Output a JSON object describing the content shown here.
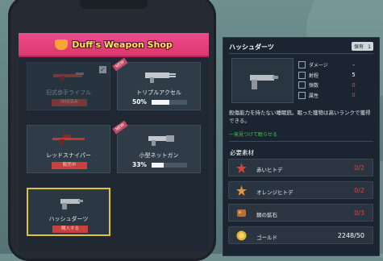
{
  "shop": {
    "title": "Duff's Weapon Shop",
    "cards": [
      {
        "name": "旧式歩手ライフル",
        "status": "owned",
        "price": "所持済み",
        "gun_color": "#b34b3e",
        "badge": ""
      },
      {
        "name": "トリプルアクセル",
        "status": "progress",
        "progress_label": "50%",
        "progress_fraction": 0.5,
        "gun_color": "#c3c8ce",
        "badge": "NEW"
      },
      {
        "name": "レッドスナイパー",
        "status": "locked",
        "price": "販売中",
        "gun_color": "#c2392f",
        "badge": ""
      },
      {
        "name": "小型ネットガン",
        "status": "progress",
        "progress_label": "33%",
        "progress_fraction": 0.33,
        "gun_color": "#c3c8ce",
        "badge": "NEW"
      },
      {
        "name": "ハッシュダーツ",
        "status": "selected",
        "price": "購入する",
        "gun_color": "#b9bec3",
        "badge": ""
      }
    ]
  },
  "detail": {
    "title": "ハッシュダーツ",
    "owned_label": "保有",
    "owned_count": "1",
    "stats": [
      {
        "label": "ダメージ",
        "value": "-",
        "color": "white"
      },
      {
        "label": "射程",
        "value": "5",
        "color": "white"
      },
      {
        "label": "弾数",
        "value": "0",
        "color": "red"
      },
      {
        "label": "属性",
        "value": "0",
        "color": "red"
      }
    ],
    "description": "殺傷能力を持たない睡眠銃。眠った獲物は高いランクで獲得できる。",
    "note": "一発見つけて眠らせる",
    "materials_heading": "必要素材",
    "materials": [
      {
        "name": "赤いヒトデ",
        "count": "0/2",
        "icon": "red-starfish-icon",
        "count_color": "red"
      },
      {
        "name": "オレンジヒトデ",
        "count": "0/2",
        "icon": "orange-starfish-icon",
        "count_color": "red"
      },
      {
        "name": "銅の鉱石",
        "count": "0/3",
        "icon": "copper-ore-icon",
        "count_color": "red"
      },
      {
        "name": "ゴールド",
        "count": "2248/50",
        "icon": "gold-coin-icon",
        "count_color": "white"
      }
    ]
  }
}
